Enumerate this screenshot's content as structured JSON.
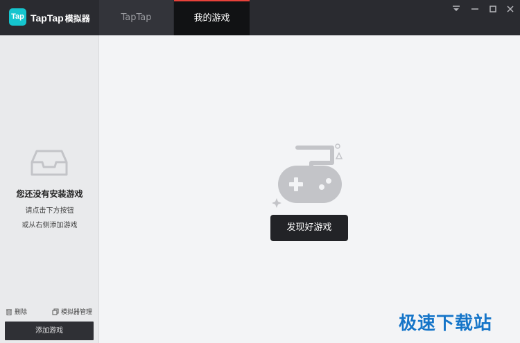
{
  "app": {
    "logo_text": "Tap",
    "brand_name": "TapTap",
    "brand_sub": "模拟器"
  },
  "tabs": [
    {
      "label": "TapTap",
      "active": false
    },
    {
      "label": "我的游戏",
      "active": true
    }
  ],
  "window_controls": {
    "menu_icon": "dropdown-menu-icon",
    "minimize_icon": "minimize-icon",
    "maximize_icon": "maximize-icon",
    "close_icon": "close-icon"
  },
  "sidebar": {
    "empty_icon": "inbox-icon",
    "empty_title": "您还没有安装游戏",
    "hint_line1": "请点击下方按钮",
    "hint_line2": "或从右侧添加游戏",
    "delete_label": "删除",
    "manage_label": "模拟器管理",
    "add_button_label": "添加游戏"
  },
  "main": {
    "illustration_icon": "gamepad-icon",
    "discover_button_label": "发现好游戏"
  },
  "watermark": "极速下载站",
  "colors": {
    "titlebar": "#2a2b30",
    "logo": "#15c5ce",
    "active_tab_accent": "#e8423a",
    "button_dark": "#222327",
    "watermark": "#1675c8"
  }
}
